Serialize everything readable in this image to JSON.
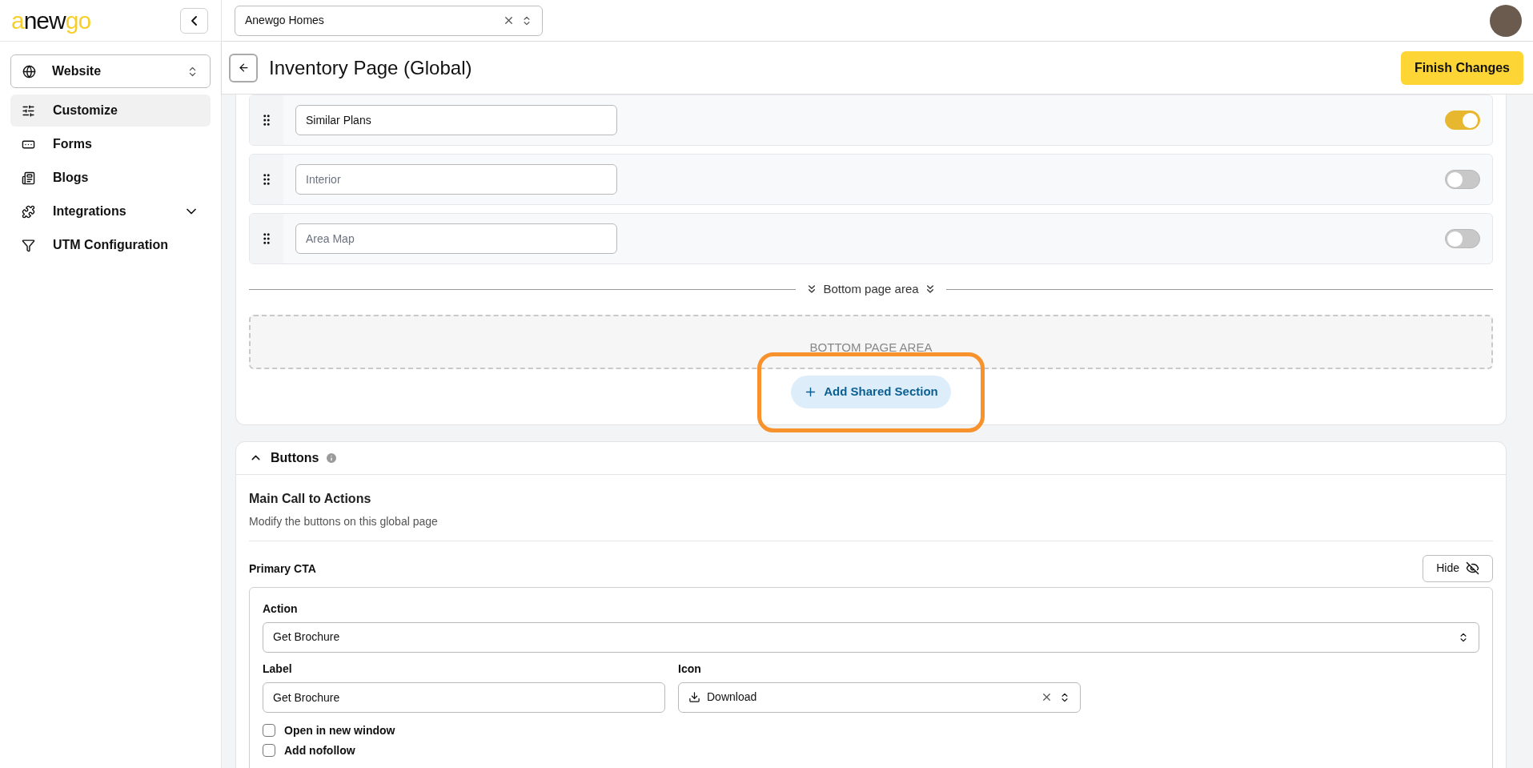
{
  "logo": [
    {
      "text": "a",
      "color": "#f7cf2d"
    },
    {
      "text": "new",
      "color": "#111111"
    },
    {
      "text": "go",
      "color": "#f7cf2d"
    }
  ],
  "site_switcher": {
    "label": "Website"
  },
  "sidebar": {
    "items": [
      {
        "label": "Customize",
        "selected": true,
        "expandable": false
      },
      {
        "label": "Forms",
        "selected": false,
        "expandable": false
      },
      {
        "label": "Blogs",
        "selected": false,
        "expandable": false
      },
      {
        "label": "Integrations",
        "selected": false,
        "expandable": true
      },
      {
        "label": "UTM Configuration",
        "selected": false,
        "expandable": false
      }
    ]
  },
  "company_select": {
    "value": "Anewgo Homes"
  },
  "page_title": "Inventory Page (Global)",
  "finish_button": "Finish Changes",
  "sections": [
    {
      "value": "Similar Plans",
      "on": true
    },
    {
      "placeholder": "Interior",
      "on": false
    },
    {
      "placeholder": "Area Map",
      "on": false
    }
  ],
  "bottom_area": {
    "divider_label": "Bottom page area",
    "drop_zone": "BOTTOM PAGE AREA",
    "add_button": "Add Shared Section",
    "highlighted": true
  },
  "buttons_panel": {
    "title": "Buttons",
    "expanded": true,
    "heading": "Main Call to Actions",
    "description": "Modify the buttons on this global page",
    "cta": {
      "title": "Primary CTA",
      "hide_button": "Hide",
      "action_label": "Action",
      "action_value": "Get Brochure",
      "label_label": "Label",
      "label_value": "Get Brochure",
      "icon_label": "Icon",
      "icon_value": "Download",
      "options": [
        {
          "label": "Open in new window",
          "checked": false
        },
        {
          "label": "Add nofollow",
          "checked": false
        }
      ]
    }
  }
}
